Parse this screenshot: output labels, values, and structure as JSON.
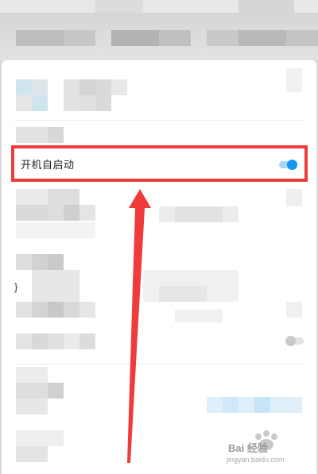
{
  "settings": {
    "auto_start_label": "开机自启动",
    "auto_start_enabled": true,
    "secondary_toggle_enabled": false
  },
  "annotation": {
    "highlight_color": "#ef3b3b",
    "arrow_color": "#ef3b3b"
  },
  "watermark": {
    "brand": "Bai 经验",
    "url": "jingyan.baidu.com"
  },
  "colors": {
    "toggle_on": "#1296f0",
    "toggle_track_on": "#a8d6f7",
    "toggle_off": "#c9c9c9"
  }
}
